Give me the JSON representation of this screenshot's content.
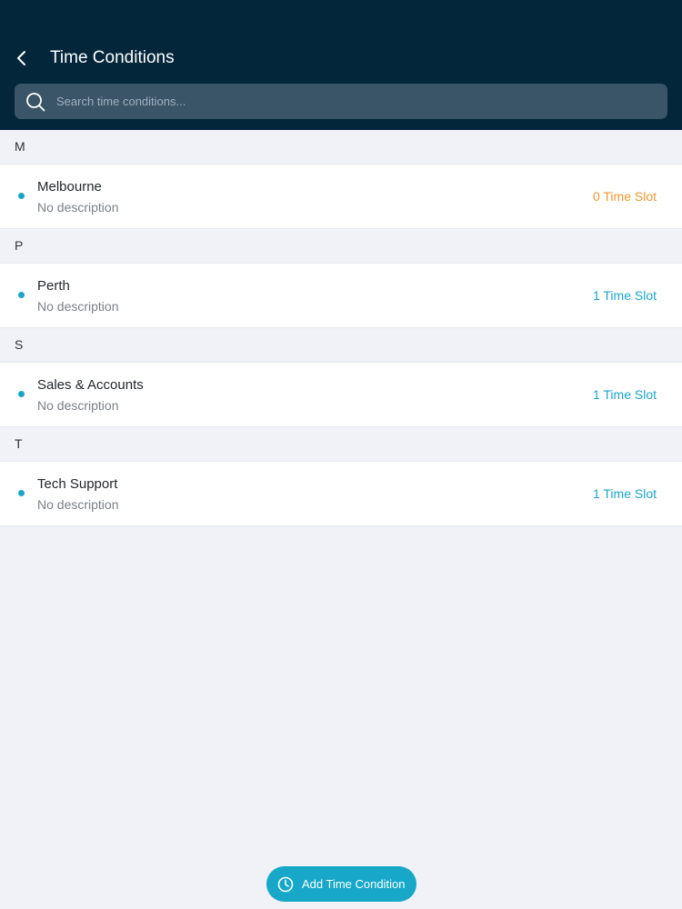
{
  "header": {
    "title": "Time Conditions",
    "back_icon": "chevron-left-icon"
  },
  "search": {
    "placeholder": "Search time conditions...",
    "value": "",
    "icon": "search-icon"
  },
  "sections": [
    {
      "letter": "M",
      "items": [
        {
          "name": "Melbourne",
          "description": "No description",
          "slots": "0 Time Slot",
          "slots_color": "#f0972f"
        }
      ]
    },
    {
      "letter": "P",
      "items": [
        {
          "name": "Perth",
          "description": "No description",
          "slots": "1 Time Slot",
          "slots_color": "#1aa5c8"
        }
      ]
    },
    {
      "letter": "S",
      "items": [
        {
          "name": "Sales & Accounts",
          "description": "No description",
          "slots": "1 Time Slot",
          "slots_color": "#1aa5c8"
        }
      ]
    },
    {
      "letter": "T",
      "items": [
        {
          "name": "Tech Support",
          "description": "No description",
          "slots": "1 Time Slot",
          "slots_color": "#1aa5c8"
        }
      ]
    }
  ],
  "fab": {
    "label": "Add Time Condition",
    "icon": "clock-icon"
  },
  "colors": {
    "header_bg": "#03263b",
    "accent": "#17a8c9",
    "warning": "#f0972f",
    "page_bg": "#f0f2f7"
  }
}
